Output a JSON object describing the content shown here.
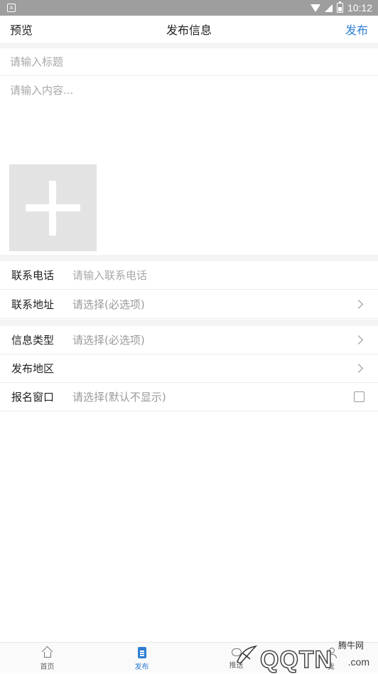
{
  "status_bar": {
    "time": "10:12"
  },
  "navbar": {
    "left": "预览",
    "title": "发布信息",
    "right": "发布"
  },
  "form": {
    "title_placeholder": "请输入标题",
    "content_placeholder": "请输入内容..."
  },
  "rows": [
    {
      "label": "联系电话",
      "placeholder": "请输入联系电话"
    },
    {
      "label": "联系地址",
      "value": "请选择(必选项)"
    },
    {
      "label": "信息类型",
      "value": "请选择(必选项)"
    },
    {
      "label": "发布地区",
      "value": ""
    },
    {
      "label": "报名窗口",
      "value": "请选择(默认不显示)"
    }
  ],
  "tabs": [
    {
      "label": "首页",
      "icon": "home-icon"
    },
    {
      "label": "发布",
      "icon": "document-icon",
      "active": true
    },
    {
      "label": "推送",
      "icon": "push-icon"
    },
    {
      "label": "我",
      "icon": "profile-icon"
    }
  ],
  "watermark": {
    "top": "腾牛网",
    "main": "QQTN",
    "sub": ".com"
  },
  "colors": {
    "accent": "#2f7fd1",
    "status_bar": "#9e9e9e",
    "separator": "#f4f4f4"
  }
}
